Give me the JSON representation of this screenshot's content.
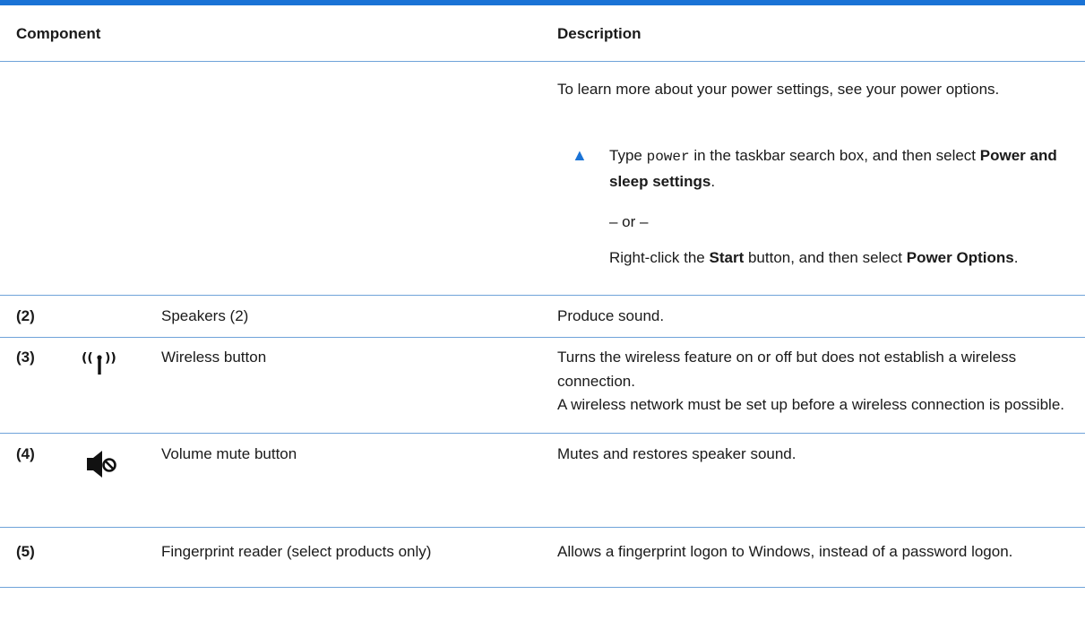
{
  "header": {
    "component": "Component",
    "description": "Description"
  },
  "power": {
    "intro": "To learn more about your power settings, see your power options.",
    "step_prefix": "Type",
    "step_code": "power",
    "step_middle": "in the taskbar search box, and then select",
    "step_bold": "Power and sleep settings",
    "step_end": ".",
    "or": "– or –",
    "alt_prefix": "Right-click the",
    "alt_bold1": "Start",
    "alt_middle": "button, and then select",
    "alt_bold2": "Power Options",
    "alt_end": "."
  },
  "rows": [
    {
      "num": "(2)",
      "component": "Speakers (2)",
      "desc": [
        "Produce sound."
      ]
    },
    {
      "num": "(3)",
      "component": "Wireless button",
      "icon": "wireless-icon",
      "desc": [
        "Turns the wireless feature on or off but does not establish a wireless connection.",
        "A wireless network must be set up before a wireless connection is possible."
      ]
    },
    {
      "num": "(4)",
      "component": "Volume mute button",
      "icon": "volume-mute-icon",
      "desc": [
        "Mutes and restores speaker sound."
      ]
    },
    {
      "num": "(5)",
      "component": "Fingerprint reader (select products only)",
      "desc": [
        "Allows a fingerprint logon to Windows, instead of a password logon."
      ]
    }
  ],
  "colors": {
    "accent": "#1a73d6",
    "rule": "#6fa3d9"
  }
}
